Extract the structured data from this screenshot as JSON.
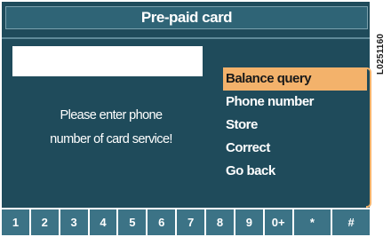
{
  "title": "Pre-paid card",
  "input": {
    "value": ""
  },
  "prompt": {
    "line1": "Please enter phone",
    "line2": "number of card service!"
  },
  "menu": {
    "items": [
      {
        "label": "Balance query",
        "selected": true
      },
      {
        "label": "Phone number",
        "selected": false
      },
      {
        "label": "Store",
        "selected": false
      },
      {
        "label": "Correct",
        "selected": false
      },
      {
        "label": "Go back",
        "selected": false
      }
    ]
  },
  "keypad": {
    "keys": [
      "1",
      "2",
      "3",
      "4",
      "5",
      "6",
      "7",
      "8",
      "9",
      "0+",
      "*",
      "#"
    ]
  },
  "image_code": "L0251160",
  "colors": {
    "background": "#1f4b5b",
    "highlight": "#f3b26b",
    "keypad": "#3c7386"
  }
}
